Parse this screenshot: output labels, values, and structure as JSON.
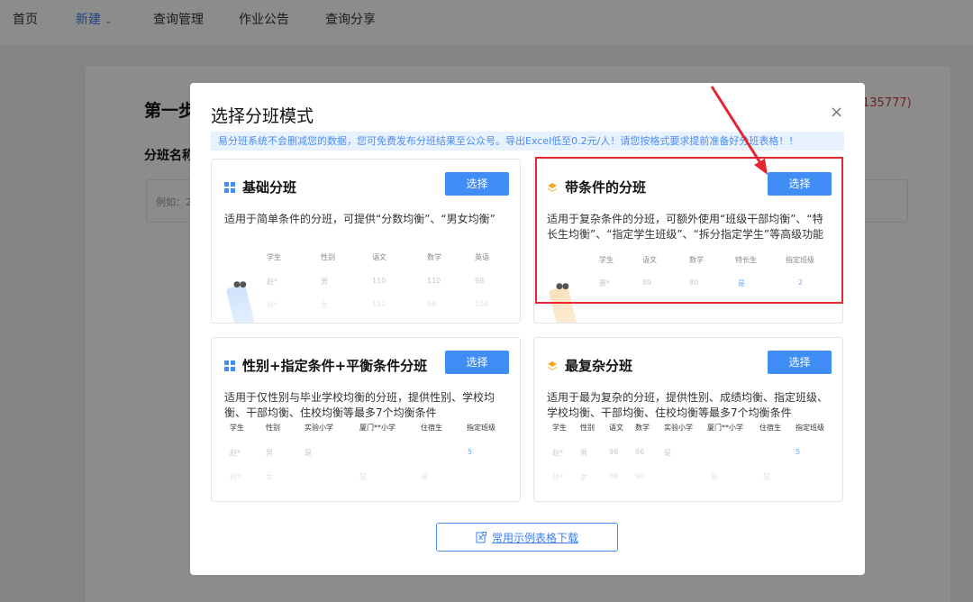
{
  "nav": {
    "items": [
      {
        "label": "首页"
      },
      {
        "label": "新建"
      },
      {
        "label": "查询管理"
      },
      {
        "label": "作业公告"
      },
      {
        "label": "查询分享"
      }
    ]
  },
  "background": {
    "step_title": "第一步",
    "name_label": "分班名称",
    "input_placeholder": "例如：2",
    "phone_fragment": "135777)"
  },
  "modal": {
    "title": "选择分班模式",
    "close": "×",
    "notice": "易分班系统不会删减您的数据，您可免费发布分班结果至公众号。导出Excel低至0.2元/人！请您按格式要求提前准备好分班表格！！",
    "select_label": "选择",
    "download_label": "常用示例表格下载",
    "cards": [
      {
        "title": "基础分班",
        "icon": "grid-icon",
        "desc": "适用于简单条件的分班，可提供“分数均衡”、“男女均衡”",
        "headers": [
          "学生",
          "性别",
          "语文",
          "数学",
          "英语"
        ],
        "rows": [
          [
            "赵*",
            "男",
            "110",
            "110",
            "98"
          ],
          [
            "孙*",
            "女",
            "112",
            "98",
            "104"
          ]
        ]
      },
      {
        "title": "带条件的分班",
        "icon": "layers-icon",
        "desc": "适用于复杂条件的分班，可额外使用“班级干部均衡”、“特长生均衡”、“指定学生班级”、“拆分指定学生”等高级功能",
        "headers": [
          "学生",
          "语文",
          "数学",
          "特长生",
          "指定班级"
        ],
        "rows": [
          [
            "赛*",
            "89",
            "80",
            "是",
            "2"
          ],
          [
            "",
            "",
            "",
            "",
            ""
          ]
        ]
      },
      {
        "title": "性别+指定条件+平衡条件分班",
        "icon": "grid-icon",
        "desc": "适用于仅性别与毕业学校均衡的分班，提供性别、学校均衡、干部均衡、住校均衡等最多7个均衡条件",
        "headers": [
          "学生",
          "性别",
          "实验小学",
          "厦门**小学",
          "住宿生",
          "指定班级"
        ],
        "rows": [
          [
            "赵*",
            "男",
            "是",
            "",
            "",
            "5"
          ],
          [
            "孙*",
            "女",
            "",
            "是",
            "是",
            ""
          ]
        ]
      },
      {
        "title": "最复杂分班",
        "icon": "layers-icon",
        "desc": "适用于最为复杂的分班，提供性别、成绩均衡、指定班级、学校均衡、干部均衡、住校均衡等最多7个均衡条件",
        "headers": [
          "学生",
          "性别",
          "语文",
          "数学",
          "实验小学",
          "厦门**小学",
          "住宿生",
          "指定班级"
        ],
        "rows": [
          [
            "赵*",
            "男",
            "98",
            "86",
            "是",
            "",
            "",
            "5"
          ],
          [
            "孙*",
            "女",
            "88",
            "90",
            "",
            "是",
            "是",
            ""
          ]
        ]
      }
    ]
  },
  "colors": {
    "accent": "#3f8df5",
    "nav_active": "#3d7dee",
    "highlight": "#e3262f",
    "notice_bg": "#e8f2ff"
  }
}
